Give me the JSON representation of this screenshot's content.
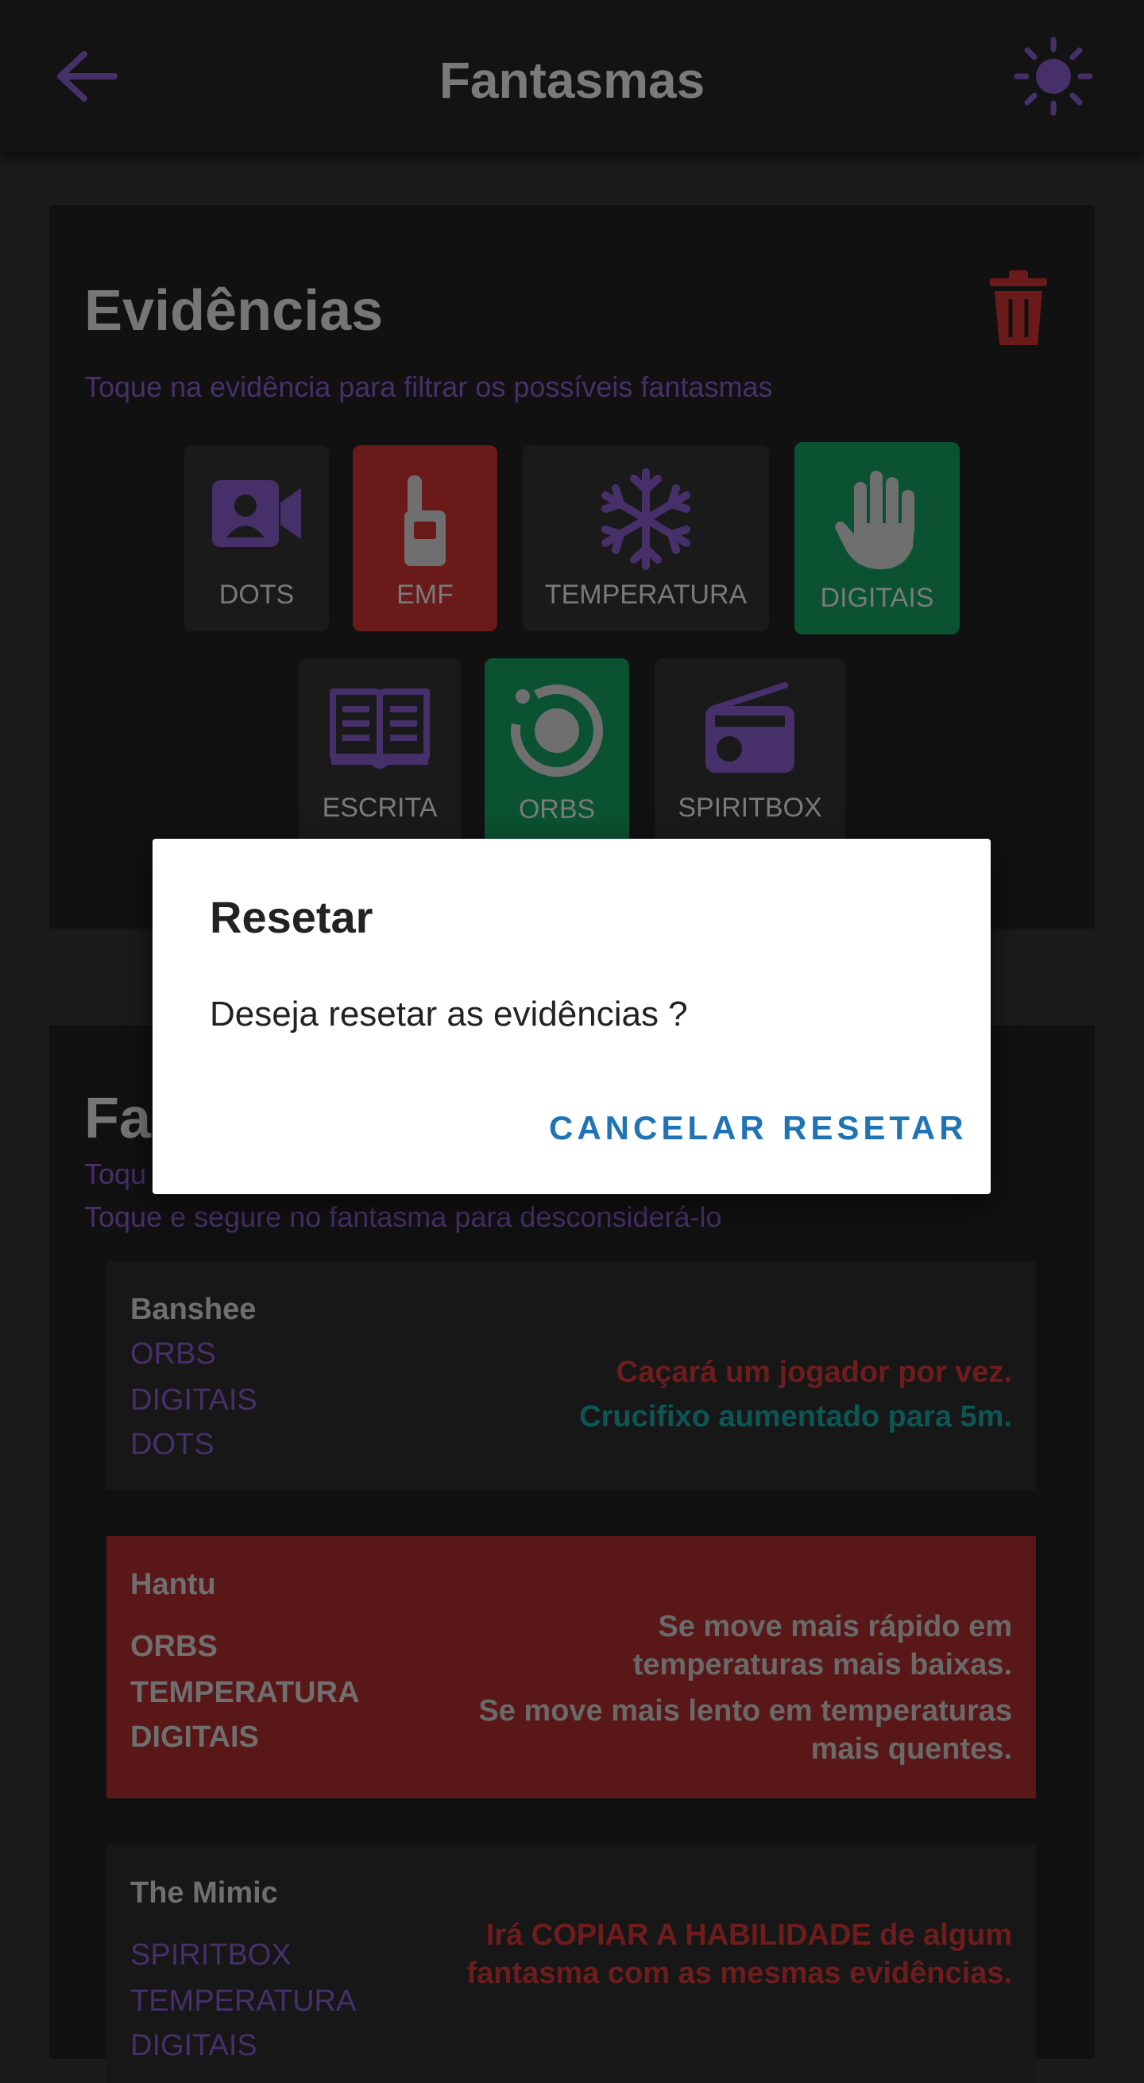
{
  "header": {
    "title": "Fantasmas"
  },
  "evidence": {
    "title": "Evidências",
    "subtitle": "Toque na evidência para filtrar os possíveis fantasmas",
    "items": [
      {
        "label": "DOTS",
        "state": "neutral",
        "icon": "video-user-icon"
      },
      {
        "label": "EMF",
        "state": "excluded",
        "icon": "emf-reader-icon"
      },
      {
        "label": "TEMPERATURA",
        "state": "neutral",
        "icon": "snowflake-icon"
      },
      {
        "label": "DIGITAIS",
        "state": "selected",
        "icon": "hand-icon"
      },
      {
        "label": "ESCRITA",
        "state": "neutral",
        "icon": "book-icon"
      },
      {
        "label": "ORBS",
        "state": "selected",
        "icon": "orb-icon"
      },
      {
        "label": "SPIRITBOX",
        "state": "neutral",
        "icon": "radio-icon"
      }
    ]
  },
  "ghosts": {
    "title_partial": "Fa",
    "hint1_partial": "Toqu",
    "hint2": "Toque e segure no fantasma para desconsiderá-lo",
    "list": [
      {
        "name": "Banshee",
        "evidences": [
          "ORBS",
          "DIGITAIS",
          "DOTS"
        ],
        "notes": [
          {
            "text": "Caçará um jogador por vez.",
            "color": "#6e1c1c"
          },
          {
            "text": "Crucifixo aumentado para 5m.",
            "color": "#0c5655"
          }
        ]
      },
      {
        "name": "Hantu",
        "evidences": [
          "ORBS",
          "TEMPERATURA",
          "DIGITAIS"
        ],
        "notes": [
          {
            "text": "Se move mais rápido em temperaturas mais baixas.",
            "color": "#6a6a6a"
          },
          {
            "text": "Se move mais lento em temperaturas mais quentes.",
            "color": "#6a6a6a"
          }
        ]
      },
      {
        "name": "The Mimic",
        "evidences": [
          "SPIRITBOX",
          "TEMPERATURA",
          "DIGITAIS"
        ],
        "notes": [
          {
            "text": "Irá COPIAR A HABILIDADE de algum fantasma com as mesmas evidências.",
            "color": "#6e1c1c"
          }
        ]
      }
    ]
  },
  "dialog": {
    "title": "Resetar",
    "message": "Deseja resetar as evidências ?",
    "cancel": "CANCELAR",
    "confirm": "RESETAR"
  },
  "colors": {
    "accent_purple": "#47306a",
    "excluded_red": "#6b1a1a",
    "selected_green": "#0b5232",
    "dialog_button_blue": "#1f74b5"
  }
}
